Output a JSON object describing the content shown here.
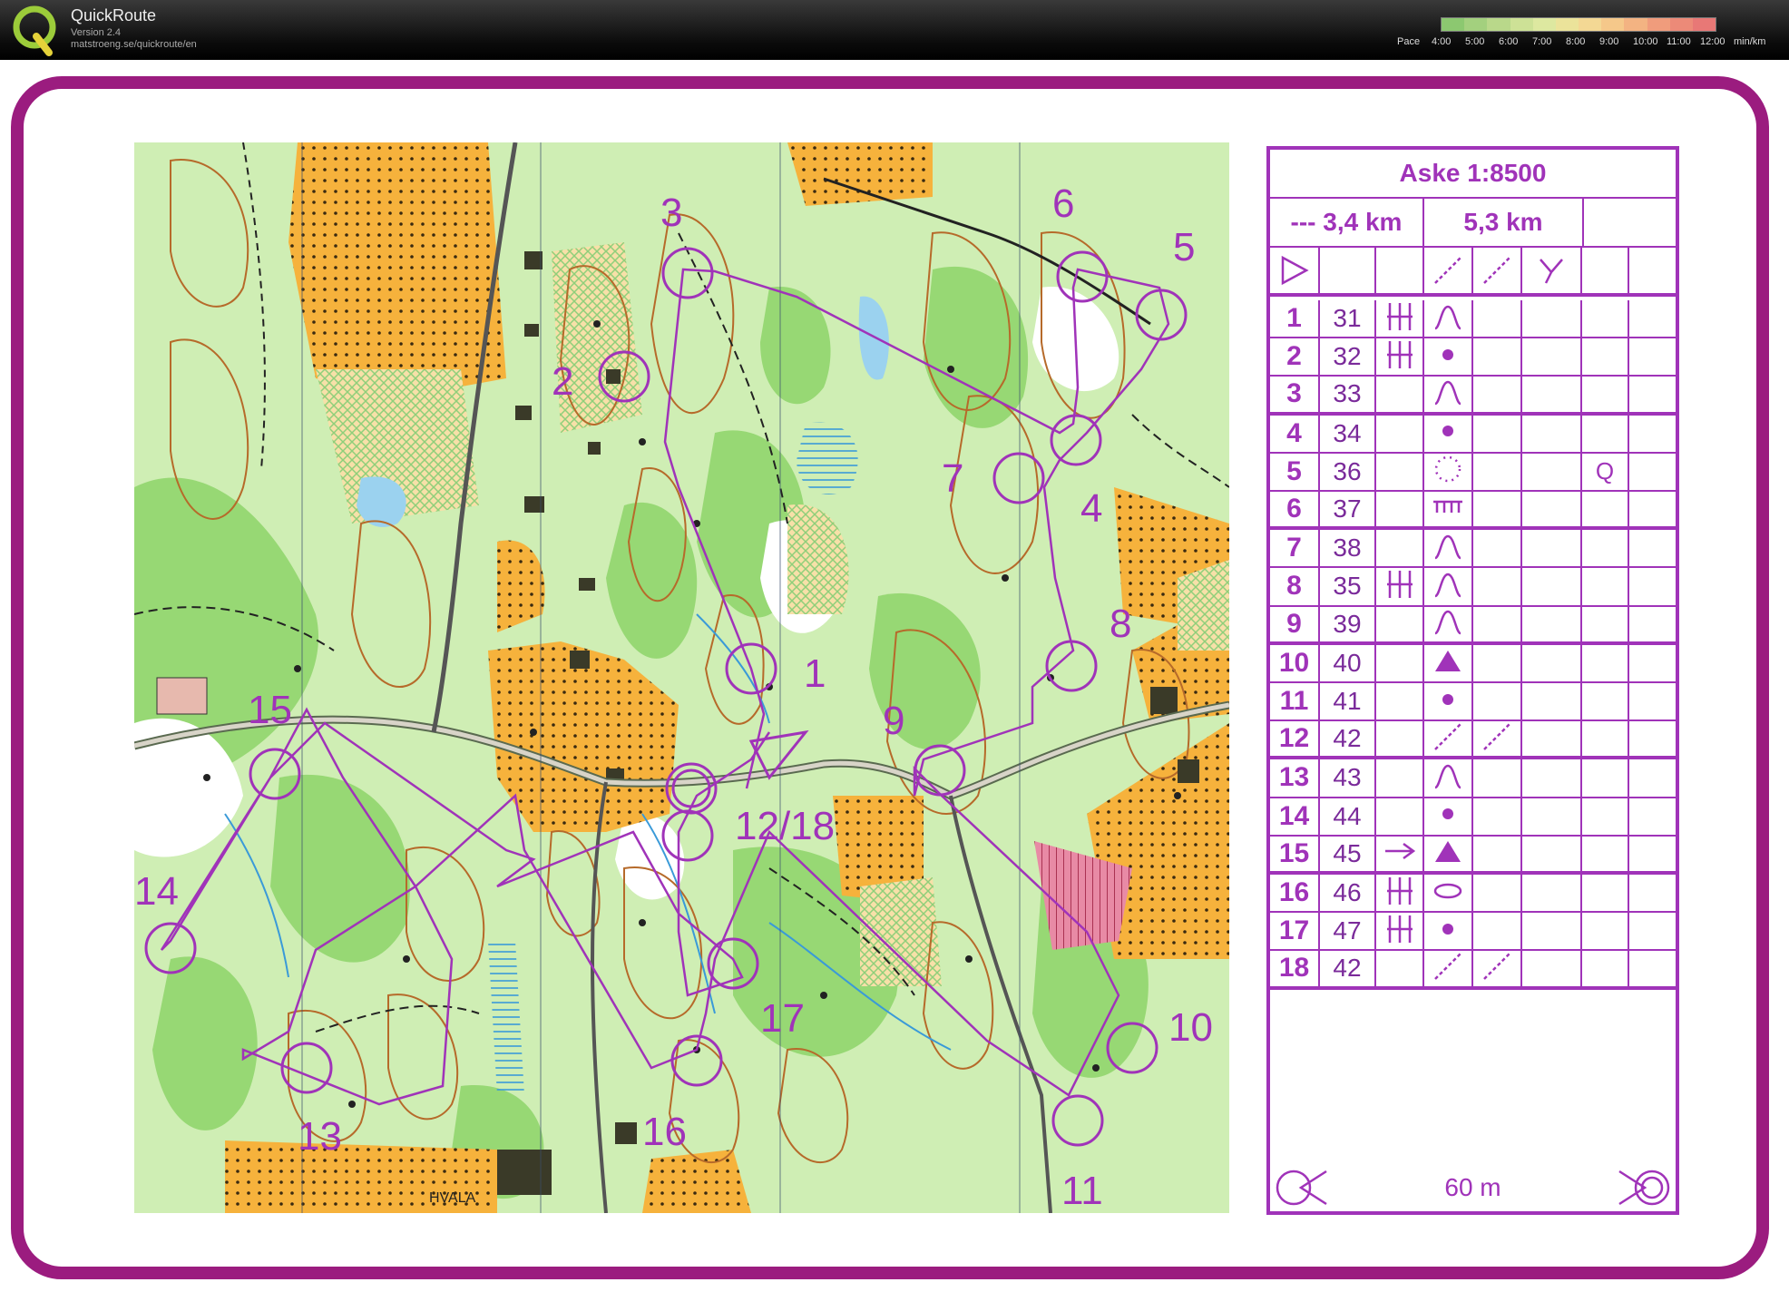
{
  "app": {
    "title": "QuickRoute",
    "version": "Version 2.4",
    "url": "matstroeng.se/quickroute/en"
  },
  "pace": {
    "label": "Pace",
    "ticks": [
      "4:00",
      "5:00",
      "6:00",
      "7:00",
      "8:00",
      "9:00",
      "10:00",
      "11:00",
      "12:00"
    ],
    "unit": "min/km",
    "colors": [
      "#8cc870",
      "#a3d07e",
      "#b9d88a",
      "#cde196",
      "#dde8a0",
      "#ebe39a",
      "#f3d894",
      "#f5c88a",
      "#f3b382",
      "#f09c7c",
      "#ec8a78",
      "#e87876"
    ]
  },
  "course": {
    "title": "Aske 1:8500",
    "length_a": "--- 3,4 km",
    "length_b": "5,3 km"
  },
  "controls": [
    {
      "num": "1",
      "code": "31",
      "c": "||",
      "d": "knoll"
    },
    {
      "num": "2",
      "code": "32",
      "c": "||",
      "d": "dot"
    },
    {
      "num": "3",
      "code": "33",
      "c": "",
      "d": "knoll"
    },
    {
      "num": "4",
      "code": "34",
      "c": "",
      "d": "dot"
    },
    {
      "num": "5",
      "code": "36",
      "c": "",
      "d": "dotring",
      "g": "Q"
    },
    {
      "num": "6",
      "code": "37",
      "c": "",
      "d": "wall"
    },
    {
      "num": "7",
      "code": "38",
      "c": "",
      "d": "knoll"
    },
    {
      "num": "8",
      "code": "35",
      "c": "||",
      "d": "knoll"
    },
    {
      "num": "9",
      "code": "39",
      "c": "",
      "d": "knoll"
    },
    {
      "num": "10",
      "code": "40",
      "c": "",
      "d": "triangle"
    },
    {
      "num": "11",
      "code": "41",
      "c": "",
      "d": "dot"
    },
    {
      "num": "12",
      "code": "42",
      "c": "",
      "d": "crossing"
    },
    {
      "num": "13",
      "code": "43",
      "c": "",
      "d": "knoll"
    },
    {
      "num": "14",
      "code": "44",
      "c": "",
      "d": "dot"
    },
    {
      "num": "15",
      "code": "45",
      "c": "arrow",
      "d": "triangle"
    },
    {
      "num": "16",
      "code": "46",
      "c": "||",
      "d": "oval"
    },
    {
      "num": "17",
      "code": "47",
      "c": "||",
      "d": "dot"
    },
    {
      "num": "18",
      "code": "42",
      "c": "",
      "d": "crossing"
    }
  ],
  "finish": {
    "distance": "60 m"
  },
  "map": {
    "control_labels": [
      "1",
      "2",
      "3",
      "4",
      "5",
      "6",
      "7",
      "8",
      "9",
      "10",
      "11",
      "12/18",
      "13",
      "14",
      "15",
      "16",
      "17"
    ],
    "place_name": "HVALA"
  }
}
